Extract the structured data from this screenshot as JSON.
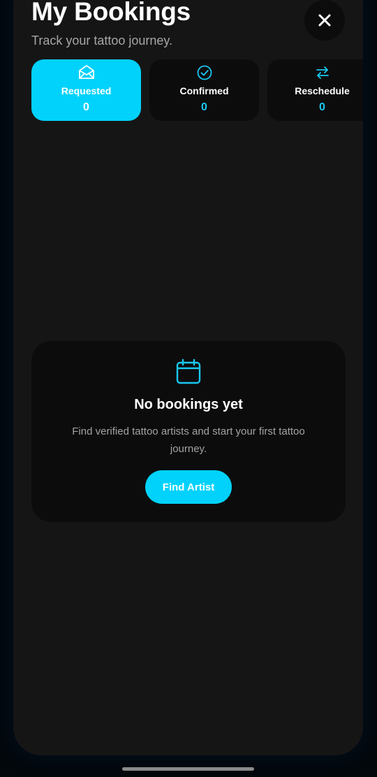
{
  "header": {
    "title": "My Bookings",
    "subtitle": "Track your tattoo journey."
  },
  "tabs": [
    {
      "label": "Requested",
      "count": "0",
      "icon": "envelope-open-icon",
      "active": true
    },
    {
      "label": "Confirmed",
      "count": "0",
      "icon": "check-circle-icon",
      "active": false
    },
    {
      "label": "Reschedule",
      "count": "0",
      "icon": "swap-arrows-icon",
      "active": false
    }
  ],
  "empty_state": {
    "icon": "calendar-icon",
    "title": "No bookings yet",
    "message": "Find verified tattoo artists and start your first tattoo journey.",
    "button_label": "Find Artist"
  },
  "colors": {
    "accent": "#00d2fb",
    "background": "#151515",
    "card": "#0c0c0d"
  }
}
